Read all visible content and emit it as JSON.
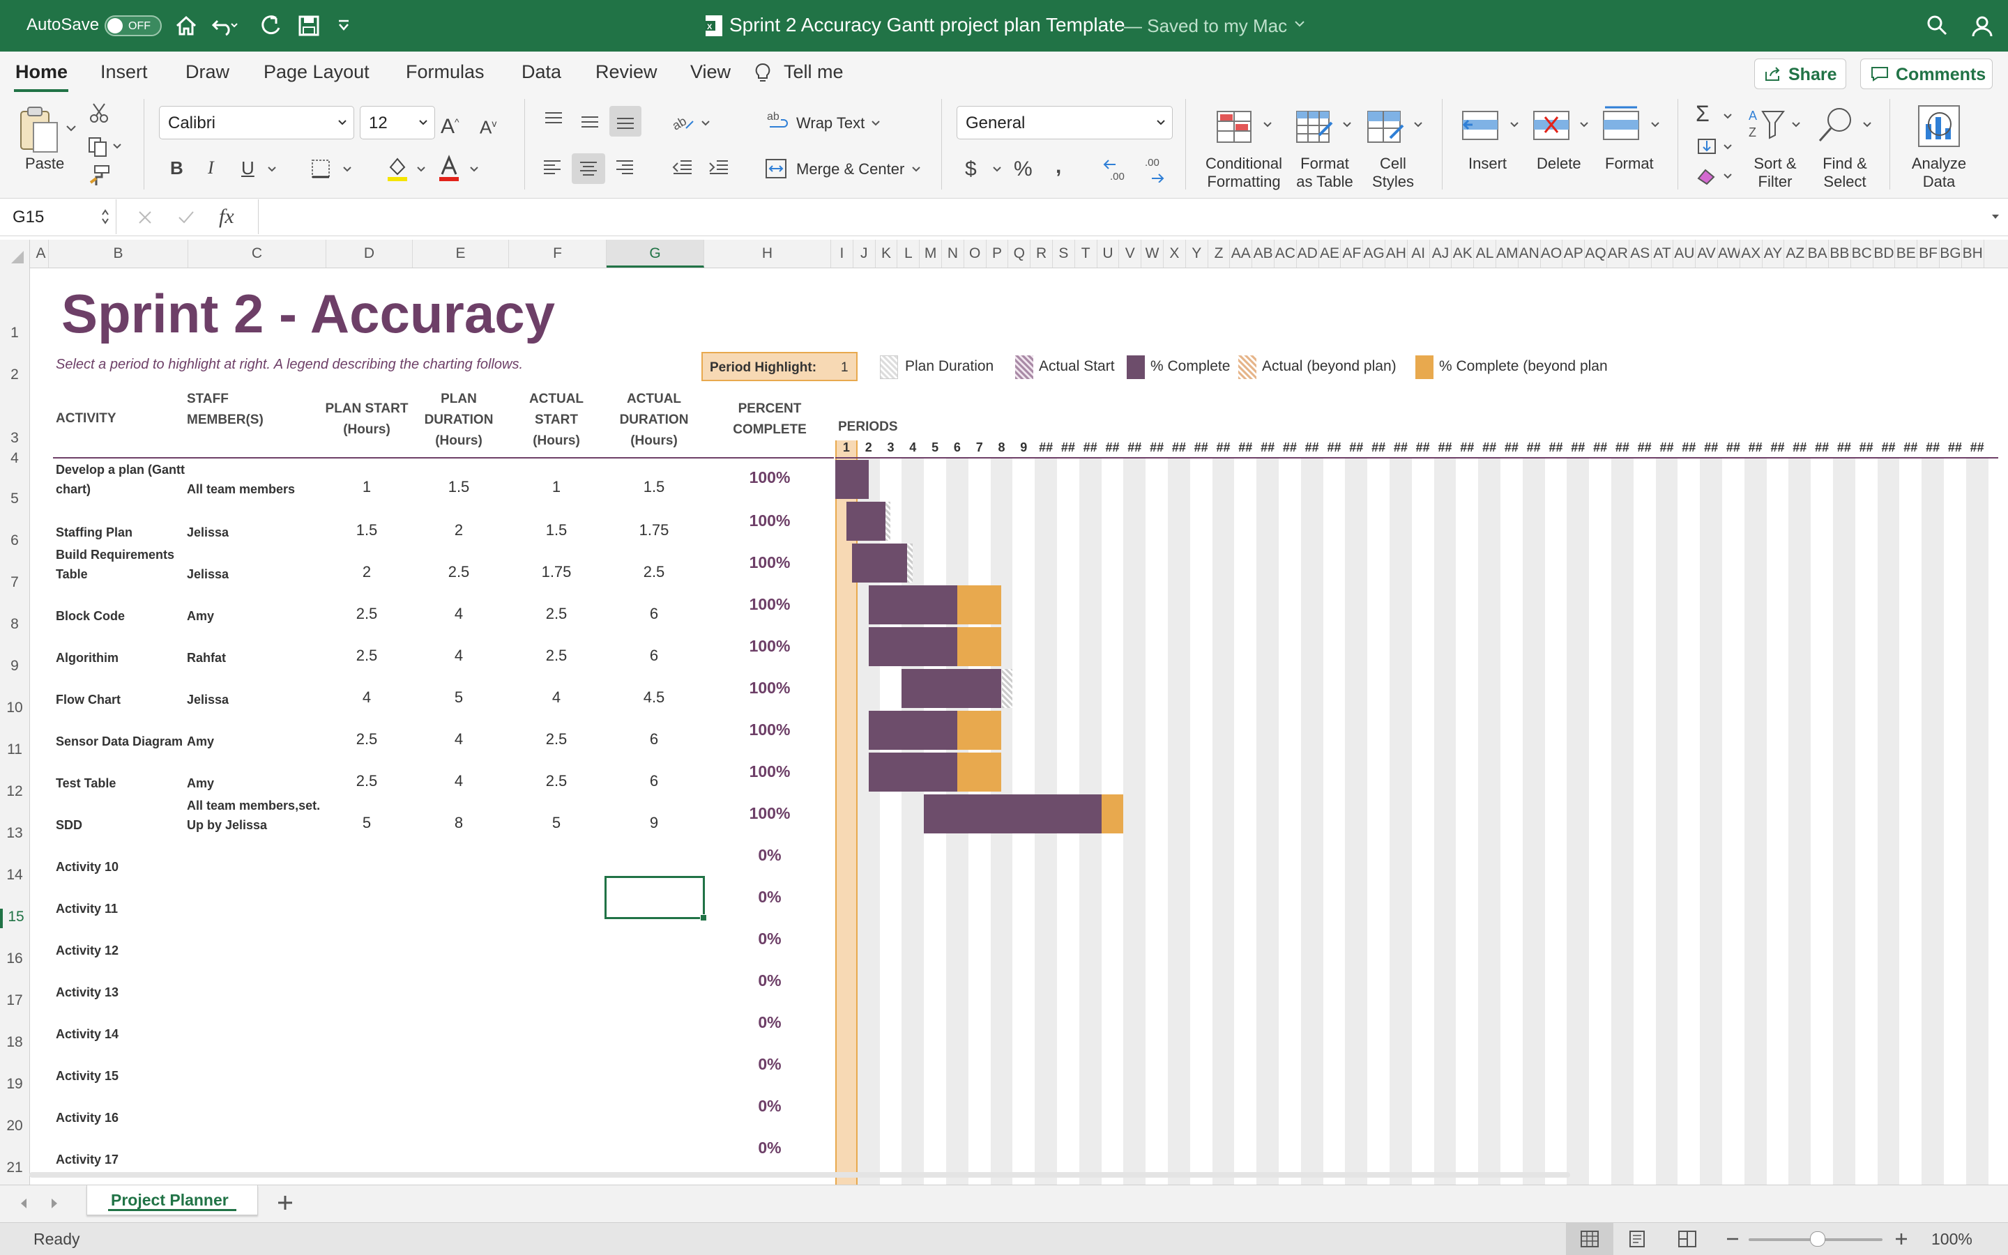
{
  "titlebar": {
    "autosave_label": "AutoSave",
    "autosave_state": "OFF",
    "doc_title": "Sprint 2 Accuracy Gantt project plan Template",
    "save_status": "— Saved to my Mac"
  },
  "ribbon_tabs": [
    "Home",
    "Insert",
    "Draw",
    "Page Layout",
    "Formulas",
    "Data",
    "Review",
    "View"
  ],
  "tell_me": "Tell me",
  "share_label": "Share",
  "comments_label": "Comments",
  "ribbon": {
    "paste": "Paste",
    "font_name": "Calibri",
    "font_size": "12",
    "wrap_text": "Wrap Text",
    "merge_center": "Merge & Center",
    "number_format": "General",
    "conditional_formatting": [
      "Conditional",
      "Formatting"
    ],
    "format_as_table": [
      "Format",
      "as Table"
    ],
    "cell_styles": [
      "Cell",
      "Styles"
    ],
    "insert": "Insert",
    "delete": "Delete",
    "format": "Format",
    "sort_filter": [
      "Sort &",
      "Filter"
    ],
    "find_select": [
      "Find &",
      "Select"
    ],
    "analyze_data": [
      "Analyze",
      "Data"
    ],
    "accent_color": "#217346"
  },
  "formula_bar": {
    "name_box": "G15",
    "fx": "fx",
    "formula": ""
  },
  "columns": [
    "A",
    "B",
    "C",
    "D",
    "E",
    "F",
    "G",
    "H",
    "I",
    "J",
    "K",
    "L",
    "M",
    "N",
    "O",
    "P",
    "Q",
    "R",
    "S",
    "T",
    "U",
    "V",
    "W",
    "X",
    "Y",
    "Z",
    "AA",
    "AB",
    "AC",
    "AD",
    "AE",
    "AF",
    "AG",
    "AH",
    "AI",
    "AJ",
    "AK",
    "AL",
    "AM",
    "AN",
    "AO",
    "AP",
    "AQ",
    "AR",
    "AS",
    "AT",
    "AU",
    "AV",
    "AW",
    "AX",
    "AY",
    "AZ",
    "BA",
    "BB",
    "BC",
    "BD",
    "BE",
    "BF",
    "BG",
    "BH"
  ],
  "selected_column": "G",
  "rows": [
    "1",
    "2",
    "3",
    "4",
    "5",
    "6",
    "7",
    "8",
    "9",
    "10",
    "11",
    "12",
    "13",
    "14",
    "15",
    "16",
    "17",
    "18",
    "19",
    "20",
    "21"
  ],
  "selected_row": "15",
  "sheet": {
    "title": "Sprint 2 - Accuracy",
    "subtitle": "Select a period to highlight at right.  A legend describing the charting follows.",
    "period_highlight_label": "Period Highlight:",
    "period_highlight_value": "1",
    "legend": [
      "Plan Duration",
      "Actual Start",
      "% Complete",
      "Actual (beyond plan)",
      "% Complete (beyond plan"
    ],
    "periods_label": "PERIODS",
    "period_numbers": [
      "1",
      "2",
      "3",
      "4",
      "5",
      "6",
      "7",
      "8",
      "9"
    ],
    "period_overflow": "##",
    "headers": {
      "activity": "ACTIVITY",
      "staff": [
        "STAFF",
        "MEMBER(S)"
      ],
      "plan_start": [
        "PLAN START",
        "(Hours)"
      ],
      "plan_duration": [
        "PLAN",
        "DURATION",
        "(Hours)"
      ],
      "actual_start": [
        "ACTUAL",
        "START",
        "(Hours)"
      ],
      "actual_duration": [
        "ACTUAL",
        "DURATION",
        "(Hours)"
      ],
      "percent_complete": [
        "PERCENT",
        "COMPLETE"
      ]
    },
    "activities": [
      {
        "name": [
          "Develop a plan (Gantt",
          "chart)"
        ],
        "staff": [
          "All team members"
        ],
        "plan_start": 1,
        "plan_duration": 1.5,
        "actual_start": 1,
        "actual_duration": 1.5,
        "percent": "100%"
      },
      {
        "name": [
          "Staffing Plan"
        ],
        "staff": [
          "Jelissa"
        ],
        "plan_start": 1.5,
        "plan_duration": 2,
        "actual_start": 1.5,
        "actual_duration": 1.75,
        "percent": "100%"
      },
      {
        "name": [
          "Build Requirements",
          "Table"
        ],
        "staff": [
          "Jelissa"
        ],
        "plan_start": 2,
        "plan_duration": 2.5,
        "actual_start": 1.75,
        "actual_duration": 2.5,
        "percent": "100%"
      },
      {
        "name": [
          "Block Code"
        ],
        "staff": [
          "Amy"
        ],
        "plan_start": 2.5,
        "plan_duration": 4,
        "actual_start": 2.5,
        "actual_duration": 6,
        "percent": "100%"
      },
      {
        "name": [
          "Algorithim"
        ],
        "staff": [
          "Rahfat"
        ],
        "plan_start": 2.5,
        "plan_duration": 4,
        "actual_start": 2.5,
        "actual_duration": 6,
        "percent": "100%"
      },
      {
        "name": [
          "Flow Chart"
        ],
        "staff": [
          "Jelissa"
        ],
        "plan_start": 4,
        "plan_duration": 5,
        "actual_start": 4,
        "actual_duration": 4.5,
        "percent": "100%"
      },
      {
        "name": [
          "Sensor Data Diagram"
        ],
        "staff": [
          "Amy"
        ],
        "plan_start": 2.5,
        "plan_duration": 4,
        "actual_start": 2.5,
        "actual_duration": 6,
        "percent": "100%"
      },
      {
        "name": [
          "Test Table"
        ],
        "staff": [
          "Amy"
        ],
        "plan_start": 2.5,
        "plan_duration": 4,
        "actual_start": 2.5,
        "actual_duration": 6,
        "percent": "100%"
      },
      {
        "name": [
          "SDD"
        ],
        "staff": [
          "All team members,set.",
          "Up by Jelissa"
        ],
        "plan_start": 5,
        "plan_duration": 8,
        "actual_start": 5,
        "actual_duration": 9,
        "percent": "100%"
      },
      {
        "name": [
          "Activity 10"
        ],
        "staff": [],
        "plan_start": null,
        "plan_duration": null,
        "actual_start": null,
        "actual_duration": null,
        "percent": "0%"
      },
      {
        "name": [
          "Activity 11"
        ],
        "staff": [],
        "plan_start": null,
        "plan_duration": null,
        "actual_start": null,
        "actual_duration": null,
        "percent": "0%"
      },
      {
        "name": [
          "Activity 12"
        ],
        "staff": [],
        "plan_start": null,
        "plan_duration": null,
        "actual_start": null,
        "actual_duration": null,
        "percent": "0%"
      },
      {
        "name": [
          "Activity 13"
        ],
        "staff": [],
        "plan_start": null,
        "plan_duration": null,
        "actual_start": null,
        "actual_duration": null,
        "percent": "0%"
      },
      {
        "name": [
          "Activity 14"
        ],
        "staff": [],
        "plan_start": null,
        "plan_duration": null,
        "actual_start": null,
        "actual_duration": null,
        "percent": "0%"
      },
      {
        "name": [
          "Activity 15"
        ],
        "staff": [],
        "plan_start": null,
        "plan_duration": null,
        "actual_start": null,
        "actual_duration": null,
        "percent": "0%"
      },
      {
        "name": [
          "Activity 16"
        ],
        "staff": [],
        "plan_start": null,
        "plan_duration": null,
        "actual_start": null,
        "actual_duration": null,
        "percent": "0%"
      },
      {
        "name": [
          "Activity 17"
        ],
        "staff": [],
        "plan_start": null,
        "plan_duration": null,
        "actual_start": null,
        "actual_duration": null,
        "percent": "0%"
      }
    ],
    "colors": {
      "title": "#6d3f67",
      "complete": "#6d4d6b",
      "beyond_plan": "#e8a94e",
      "highlight": "#f7d9b4",
      "highlight_border": "#e8a94e"
    }
  },
  "sheet_tab": "Project Planner",
  "status": {
    "ready": "Ready",
    "zoom": "100%"
  }
}
